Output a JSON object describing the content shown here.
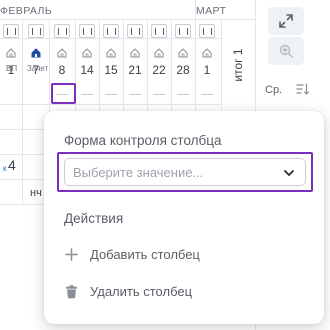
{
  "months": [
    "ФЕВРАЛЬ",
    "МАРТ"
  ],
  "columns": [
    {
      "day": "1",
      "icon": "house-outline-icon",
      "active": false
    },
    {
      "day": "7",
      "icon": "house-filled-icon",
      "active": true
    },
    {
      "day": "8",
      "icon": "house-outline-icon",
      "active": false
    },
    {
      "day": "14",
      "icon": "house-outline-icon",
      "active": false
    },
    {
      "day": "15",
      "icon": "house-outline-icon",
      "active": false
    },
    {
      "day": "21",
      "icon": "house-outline-icon",
      "active": false
    },
    {
      "day": "22",
      "icon": "house-outline-icon",
      "active": false
    },
    {
      "day": "28",
      "icon": "house-outline-icon",
      "active": false
    },
    {
      "day": "1",
      "icon": "house-outline-icon",
      "active": false
    }
  ],
  "labels": {
    "vp": "ВП",
    "zachet": "Зачет"
  },
  "itog": "итог 1",
  "rows": {
    "k_label": "к",
    "value": "4",
    "nch": "нч"
  },
  "right_panel": {
    "sr_label": "Ср."
  },
  "popup": {
    "title": "Форма контроля столбца",
    "select_placeholder": "Выберите значение...",
    "actions_title": "Действия",
    "add_label": "Добавить столбец",
    "delete_label": "Удалить столбец"
  },
  "colors": {
    "accent": "#7b2fbf",
    "link": "#1e6bd6",
    "active_icon": "#1e4fa0"
  }
}
